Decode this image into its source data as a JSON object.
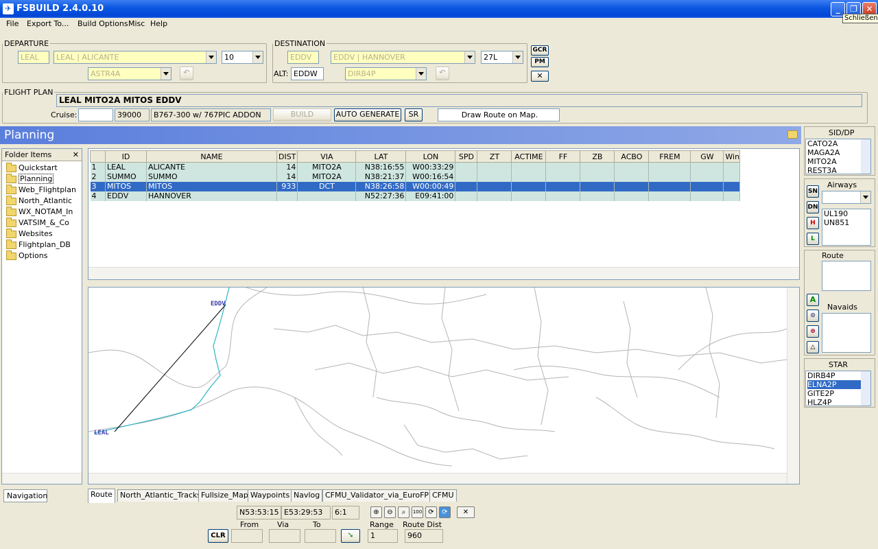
{
  "window": {
    "title": "FSBUILD 2.4.0.10",
    "tooltip": "Schließen"
  },
  "menu": [
    "File",
    "Export To...",
    "Build Options",
    "Misc",
    "Help"
  ],
  "departure": {
    "label": "DEPARTURE",
    "icao": "LEAL",
    "airport": "LEAL | ALICANTE",
    "runway": "10",
    "sid": "ASTR4A"
  },
  "destination": {
    "label": "DESTINATION",
    "icao": "EDDV",
    "airport": "EDDV | HANNOVER",
    "runway": "27L",
    "alt_label": "ALT:",
    "alt": "EDDW",
    "star": "DIRB4P"
  },
  "side_buttons": {
    "gcr": "GCR",
    "pm": "PM"
  },
  "flight_plan": {
    "label": "FLIGHT PLAN",
    "route": "LEAL MITO2A MITOS EDDV",
    "cruise_label": "Cruise:",
    "cruise": "",
    "altitude": "39000",
    "aircraft": "B767-300 w/ 767PIC ADDON",
    "build": "BUILD",
    "auto": "AUTO GENERATE",
    "sr": "SR",
    "draw": "Draw Route on Map."
  },
  "panel": {
    "title": "Planning"
  },
  "folders": {
    "header": "Folder Items",
    "items": [
      "Quickstart",
      "Planning",
      "Web_Flightplan",
      "North_Atlantic",
      "WX_NOTAM_In",
      "VATSIM_&_Co",
      "Websites",
      "Flightplan_DB",
      "Options"
    ],
    "nav_tab": "Navigation"
  },
  "grid": {
    "columns": [
      "",
      "ID",
      "NAME",
      "DIST",
      "VIA",
      "LAT",
      "LON",
      "SPD",
      "ZT",
      "ACTIME",
      "FF",
      "ZB",
      "ACBO",
      "FREM",
      "GW",
      "Wind"
    ],
    "rows": [
      [
        "1",
        "LEAL",
        "ALICANTE",
        "14",
        "MITO2A",
        "N38:16:55",
        "W00:33:29"
      ],
      [
        "2",
        "SUMMO",
        "SUMMO",
        "14",
        "MITO2A",
        "N38:21:37",
        "W00:16:54"
      ],
      [
        "3",
        "MITOS",
        "MITOS",
        "933",
        "DCT",
        "N38:26:58",
        "W00:00:49"
      ],
      [
        "4",
        "EDDV",
        "HANNOVER",
        "",
        "",
        "N52:27:36",
        "E09:41:00"
      ]
    ]
  },
  "map_labels": {
    "dest": "EDDV",
    "dep": "LEAL"
  },
  "tabs": [
    "Route",
    "North_Atlantic_Tracks",
    "Fullsize_Map",
    "Waypoints",
    "Navlog",
    "CFMU_Validator_via_EuroFPL",
    "CFMU"
  ],
  "status": {
    "lat": "N53:53:15",
    "lon": "E53:29:53",
    "scale": "6:1",
    "from_label": "From",
    "via_label": "Via",
    "to_label": "To",
    "range_label": "Range",
    "range": "1",
    "dist_label": "Route Dist",
    "dist": "960",
    "clr": "CLR"
  },
  "sid": {
    "label": "SID/DP",
    "items": [
      "CATO2A",
      "MAGA2A",
      "MITO2A",
      "REST3A"
    ]
  },
  "airways": {
    "label": "Airways",
    "items": [
      "UL190",
      "UN851"
    ],
    "buttons": [
      "SN",
      "DN",
      "H",
      "L"
    ]
  },
  "route_box": {
    "label": "Route"
  },
  "navaids": {
    "label": "Navaids",
    "button": "A"
  },
  "star": {
    "label": "STAR",
    "items": [
      "DIRB4P",
      "ELNA2P",
      "GITE2P",
      "HLZ4P"
    ],
    "selected": 1
  },
  "colors": {
    "title_bar": "#0a56e0",
    "selection": "#316ac5",
    "row_fill": "#cfe6e0",
    "route_track": "#2bb4c4"
  }
}
